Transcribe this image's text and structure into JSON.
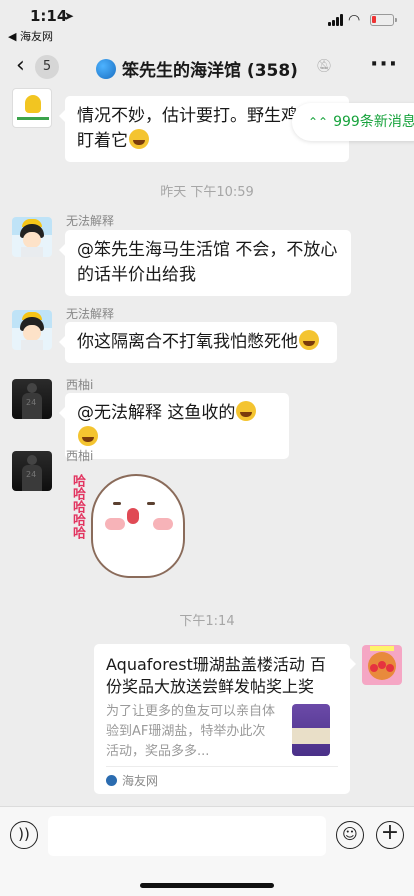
{
  "status_bar": {
    "time": "1:14",
    "back_app": "◀ 海友网"
  },
  "nav": {
    "unread_count": "5",
    "title": "笨先生的海洋馆",
    "member_count": "(358)"
  },
  "new_messages_pill": "999条新消息",
  "messages": [
    {
      "sender": "",
      "text": "情况不妙，估计要打。野生鸡 直盯着它",
      "has_emoji": true
    },
    {
      "timestamp": "昨天 下午10:59"
    },
    {
      "sender": "无法解释",
      "text": "@笨先生海马生活馆 不会，不放心的话半价出给我"
    },
    {
      "sender": "无法解释",
      "text": "你这隔离合不打氧我怕憋死他",
      "has_emoji": true
    },
    {
      "sender": "西柚i",
      "text": "@无法解释 这鱼收的",
      "has_emoji": true
    },
    {
      "sender": "西柚i",
      "sticker_text": "哈哈哈哈哈"
    },
    {
      "timestamp": "下午1:14"
    }
  ],
  "link_card": {
    "title": "Aquaforest珊湖盐盖楼活动 百份奖品大放送尝鲜发帖奖上奖",
    "description": "为了让更多的鱼友可以亲自体验到AF珊湖盐，特举办此次活动，奖品多多...",
    "source": "海友网"
  },
  "icons": {
    "back": "chevron-left-icon",
    "more": "more-icon",
    "mute": "mute-bell-icon",
    "voice": "voice-icon",
    "emoji": "emoji-icon",
    "plus": "plus-icon"
  },
  "colors": {
    "accent_green": "#18a33d",
    "background": "#ededed",
    "bubble": "#ffffff"
  }
}
